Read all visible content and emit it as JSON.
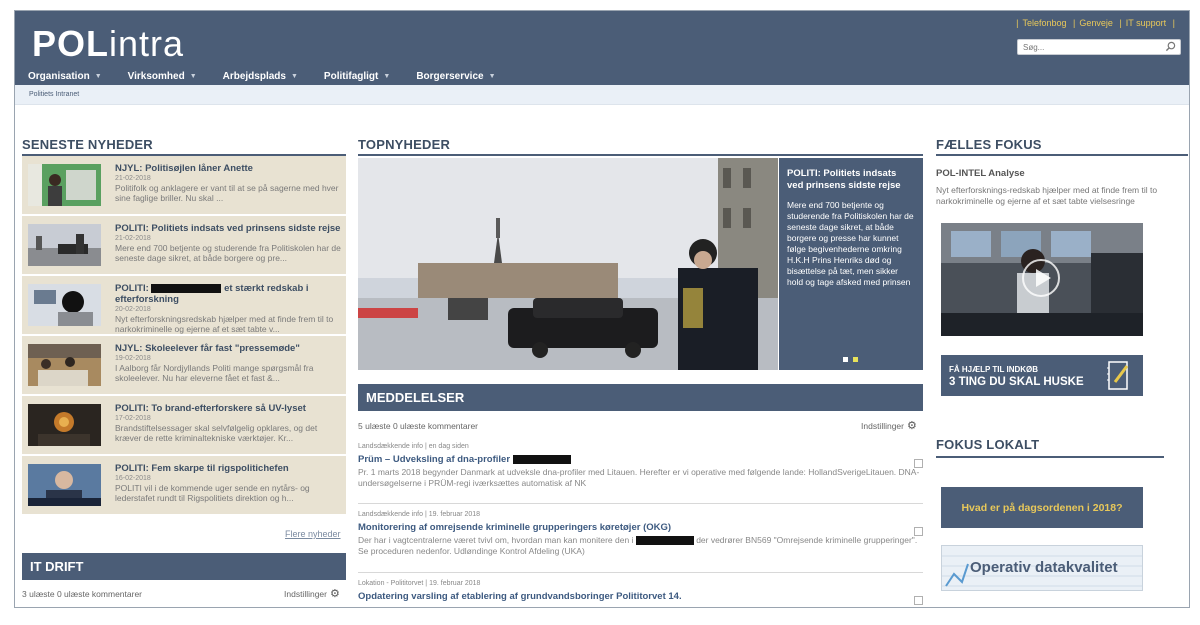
{
  "header": {
    "logo_bold": "POL",
    "logo_light": "intra",
    "links": [
      "Telefonbog",
      "Genveje",
      "IT support"
    ],
    "search_placeholder": "Søg..."
  },
  "nav": [
    "Organisation",
    "Virksomhed",
    "Arbejdsplads",
    "Politifagligt",
    "Borgerservice"
  ],
  "breadcrumb": "Politiets Intranet",
  "seneste": {
    "title": "SENESTE NYHEDER",
    "items": [
      {
        "title": "NJYL: Politisøjlen låner Anette",
        "date": "21-02-2018",
        "text": "Politifolk og anklagere er vant til at se på sagerne med hver sine faglige briller. Nu skal ..."
      },
      {
        "title": "POLITI: Politiets indsats ved prinsens sidste rejse",
        "date": "21-02-2018",
        "text": "Mere end 700 betjente og studerende fra Politiskolen har de seneste dage sikret, at både borgere og pre..."
      },
      {
        "title_a": "POLITI:",
        "title_b": "et stærkt redskab i efterforskning",
        "date": "20-02-2018",
        "text": "Nyt efterforskningsredskab hjælper med at finde frem til to narkokriminelle og ejerne af et sæt tabte v..."
      },
      {
        "title": "NJYL: Skoleelever får fast \"pressemøde\"",
        "date": "19-02-2018",
        "text": "I Aalborg får Nordjyllands Politi mange spørgsmål fra skoleelever. Nu har eleverne fået et fast &..."
      },
      {
        "title": "POLITI: To brand-efterforskere så UV-lyset",
        "date": "17-02-2018",
        "text": "Brandstiftelsessager skal selvfølgelig opklares, og det kræver de rette kriminaltekniske værktøjer. Kr..."
      },
      {
        "title": "POLITI: Fem skarpe til rigspolitichefen",
        "date": "16-02-2018",
        "text": "POLITI vil i de kommende uger sende en nytårs- og lederstafet rundt til Rigspolitiets direktion og h..."
      }
    ],
    "more": "Flere nyheder"
  },
  "itdrift": {
    "title": "IT DRIFT",
    "stats": "3 ulæste    0 ulæste kommentarer",
    "settings": "Indstillinger"
  },
  "top": {
    "title": "TOPNYHEDER",
    "caption_title": "POLITI: Politiets indsats ved prinsens sidste rejse",
    "caption_text": "Mere end 700 betjente og studerende fra Politiskolen har de seneste dage sikret, at både borgere og presse har kunnet følge begivenhederne omkring H.K.H Prins Henriks død og bisættelse på tæt, men sikker hold og tage afsked med prinsen"
  },
  "meddelelser": {
    "title": "MEDDELELSER",
    "stats": "5 ulæste    0 ulæste kommentarer",
    "settings": "Indstillinger",
    "items": [
      {
        "meta": "Landsdækkende info  |  en dag siden",
        "title": "Prüm – Udveksling af dna-profiler",
        "text": "Pr. 1 marts 2018 begynder Danmark at udveksle dna-profiler med Litauen. Herefter er vi operative med følgende lande: HollandSverigeLitauen. DNA-undersøgelserne i PRÜM-regi iværksættes automatisk af NK"
      },
      {
        "meta": "Landsdækkende info  |  19. februar 2018",
        "title": "Monitorering af omrejsende kriminelle grupperingers køretøjer (OKG)",
        "text_a": "Der har i vagtcentralerne været tvivl om, hvordan man kan monitere den i",
        "text_b": "der vedrører BN569 \"Omrejsende kriminelle grupperinger\". Se proceduren nedenfor. Udløndinge Kontrol Afdeling (UKA)"
      },
      {
        "meta": "Lokation - Polititorvet  |  19. februar 2018",
        "title": "Opdatering varsling af etablering af grundvandsboringer Polititorvet 14."
      }
    ]
  },
  "faelles": {
    "title": "FÆLLES FOKUS",
    "sub": "POL-INTEL Analyse",
    "text": "Nyt efterforsknings-redskab hjælper med at finde frem til to narkokriminelle og ejerne af et sæt tabte vielsesringe",
    "help_small": "FÅ HJÆLP TIL INDKØB",
    "help_big": "3 TING DU SKAL HUSKE"
  },
  "lokalt": {
    "title": "FOKUS LOKALT",
    "dagsorden": "Hvad er på dagsordenen i 2018?",
    "operativ": "Operativ datakvalitet"
  }
}
